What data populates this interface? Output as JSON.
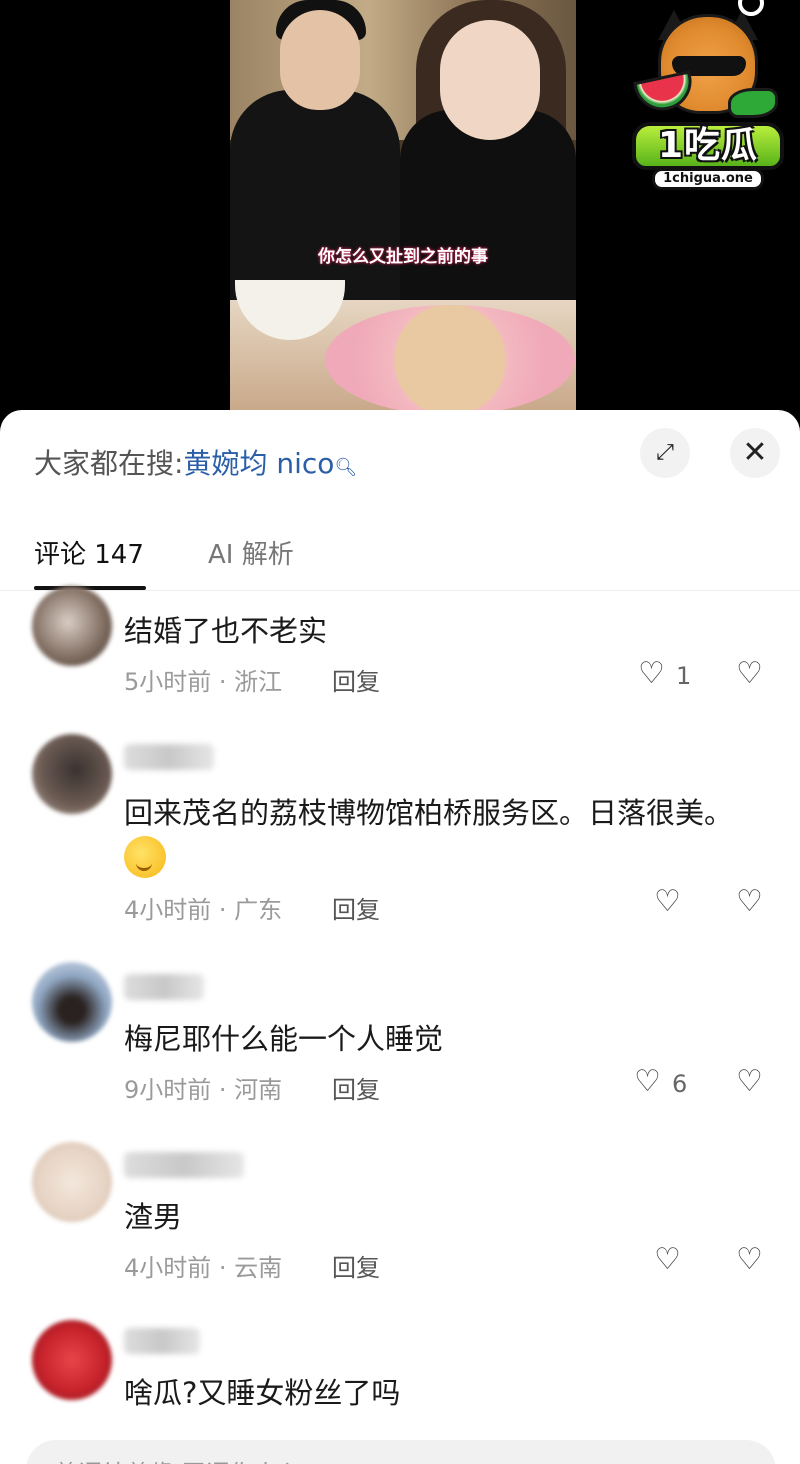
{
  "video": {
    "subtitle": "你怎么又扯到之前的事"
  },
  "watermark": {
    "brand": "1吃瓜",
    "url": "1chigua.one"
  },
  "sheet": {
    "hot_search_prefix": "大家都在搜:",
    "hot_search_term": "黄婉均 nico",
    "expand_icon": "⤢",
    "close_icon": "✕",
    "tabs": [
      {
        "label": "评论 147",
        "active": true
      },
      {
        "label": "AI 解析",
        "active": false
      }
    ],
    "reply_label": "回复",
    "comments": [
      {
        "text": "结婚了也不老实",
        "meta": "5小时前 · 浙江",
        "likes": "1",
        "avatar_color": "#7d6a5e"
      },
      {
        "text": "回来茂名的荔枝博物馆柏桥服务区。日落很美。",
        "meta": "4小时前 · 广东",
        "likes": "",
        "emoji": true,
        "avatar_color": "#5a4a44"
      },
      {
        "text": "梅尼耶什么能一个人睡觉",
        "meta": "9小时前 · 河南",
        "likes": "6",
        "avatar_color": "#8fa6c2"
      },
      {
        "text": "渣男",
        "meta": "4小时前 · 云南",
        "likes": "",
        "avatar_color": "#e6d3c4"
      },
      {
        "text": "啥瓜?又睡女粉丝了吗",
        "meta": "",
        "likes": "",
        "avatar_color": "#c8232c"
      }
    ],
    "input_placeholder": "善语结善缘,恶语伤人心"
  }
}
